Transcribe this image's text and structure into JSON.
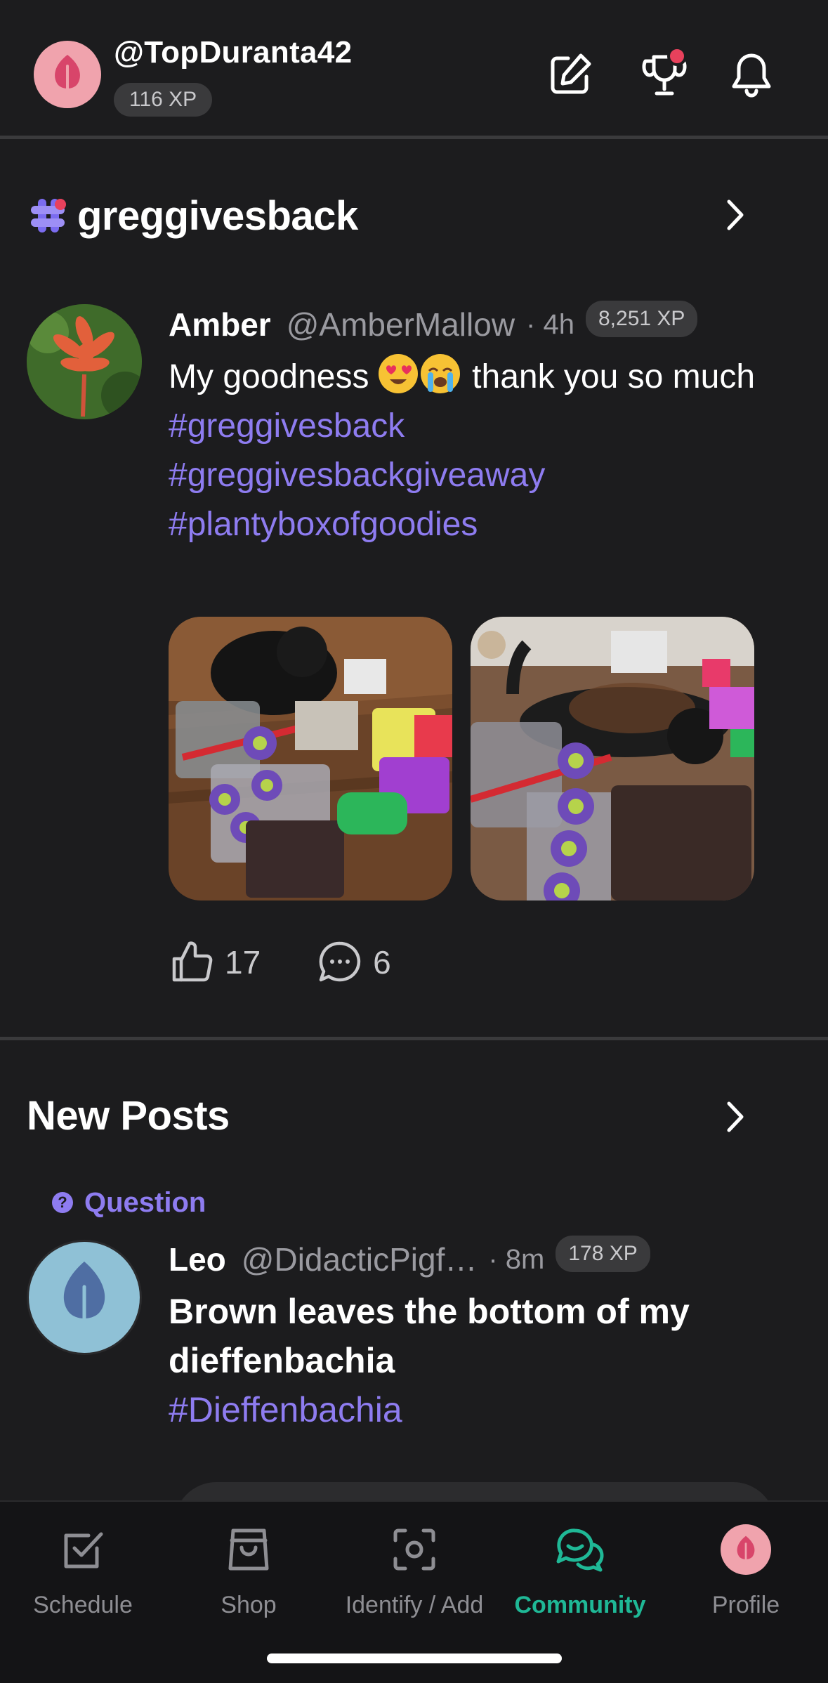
{
  "header": {
    "username": "@TopDuranta42",
    "xp": "116 XP",
    "icons": [
      "compose-icon",
      "trophy-icon",
      "bell-icon"
    ],
    "trophy_badge_color": "#e8415c"
  },
  "group": {
    "name": "greggivesback",
    "icon": "hashtag-icon",
    "post": {
      "author": "Amber",
      "handle": "@AmberMallow",
      "age": "· 4h",
      "xp": "8,251 XP",
      "text_before": "My goodness ",
      "emojis": [
        "heart-eyes-emoji",
        "loudly-crying-emoji"
      ],
      "text_after": " thank you so much",
      "hashtags": [
        "#greggivesback",
        "#greggivesbackgiveaway",
        "#plantyboxofgoodies"
      ],
      "photos": [
        "photo-cat-plant-supplies-1",
        "photo-cat-plant-supplies-2"
      ],
      "likes": "17",
      "comments": "6"
    }
  },
  "new_posts": {
    "title": "New Posts",
    "post": {
      "tag": "Question",
      "tag_glyph": "?",
      "author": "Leo",
      "handle": "@DidacticPigf…",
      "age": "· 8m",
      "xp": "178 XP",
      "title": "Brown leaves the bottom of my dieffenbachia",
      "hashtag": "#Dieffenbachia"
    }
  },
  "tabs": [
    {
      "label": "Schedule",
      "icon": "checkbox-icon",
      "active": false
    },
    {
      "label": "Shop",
      "icon": "shopping-bag-icon",
      "active": false
    },
    {
      "label": "Identify / Add",
      "icon": "camera-scan-icon",
      "active": false
    },
    {
      "label": "Community",
      "icon": "chat-bubbles-icon",
      "active": true
    },
    {
      "label": "Profile",
      "icon": "profile-leaf-icon",
      "active": false
    }
  ],
  "colors": {
    "background": "#1c1c1e",
    "accent_purple": "#8e7cf0",
    "accent_green": "#1fb896",
    "avatar_pink": "#f0a3ad",
    "avatar_blue": "#8fc1d6"
  }
}
